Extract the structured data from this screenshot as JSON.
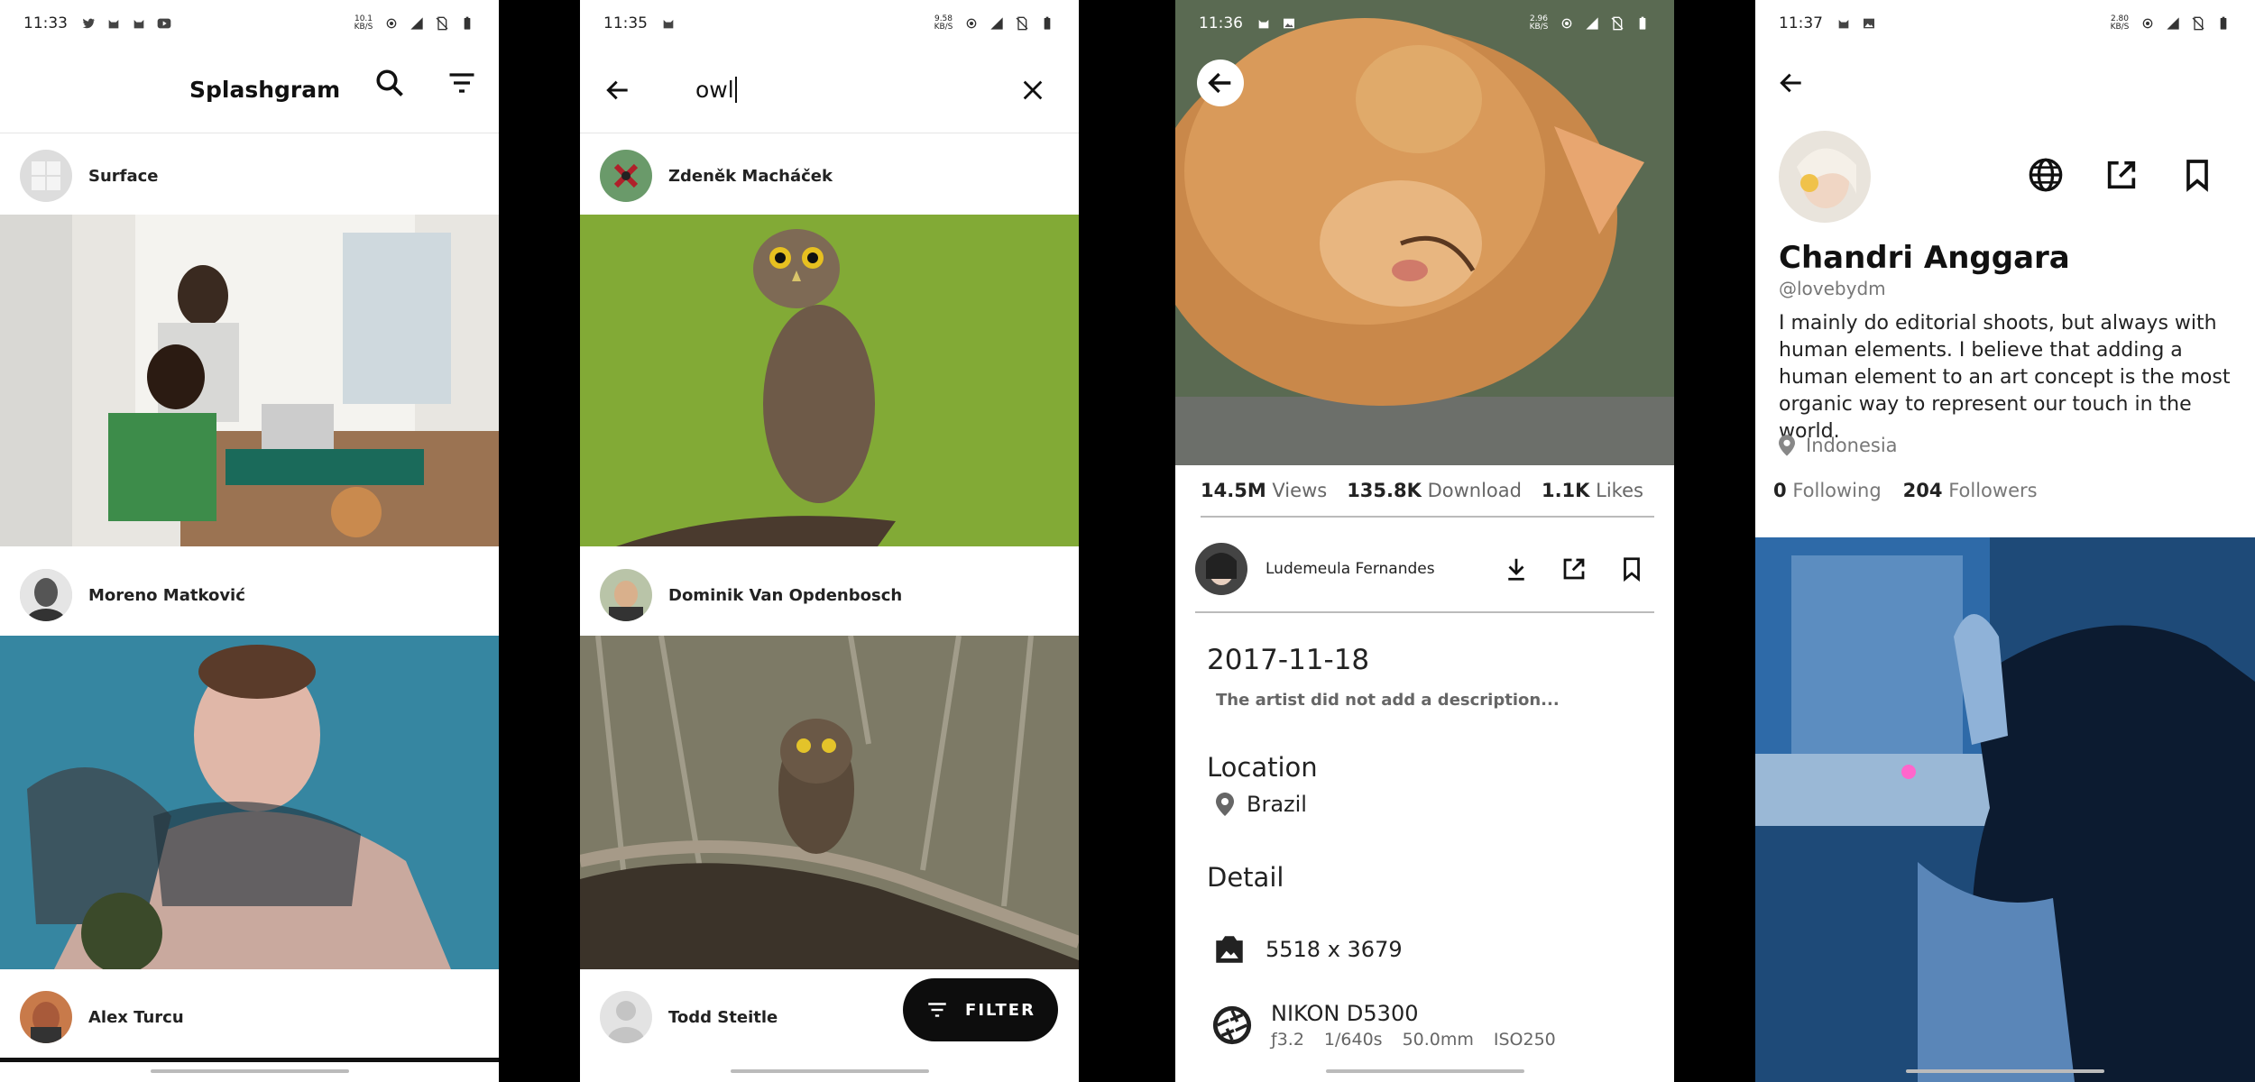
{
  "colors": {
    "accent": "#111111",
    "fab": "#0d0d0d"
  },
  "screen1": {
    "status": {
      "time": "11:33",
      "netspeed": "10.1 KB/S",
      "network": "4G"
    },
    "app_title": "Splashgram",
    "feed": [
      {
        "author": "Surface"
      },
      {
        "author": "Moreno Matković"
      },
      {
        "author": "Alex Turcu"
      }
    ]
  },
  "screen2": {
    "status": {
      "time": "11:35",
      "netspeed": "9.58 KB/S",
      "network": "4G"
    },
    "search_query": "owl",
    "results": [
      {
        "author": "Zdeněk Macháček"
      },
      {
        "author": "Dominik Van Opdenbosch"
      },
      {
        "author": "Todd Steitle"
      }
    ],
    "filter_label": "FILTER"
  },
  "screen3": {
    "status": {
      "time": "11:36",
      "netspeed": "2.96 KB/S",
      "network": "4G"
    },
    "stats": [
      {
        "value": "14.5M",
        "label": "Views"
      },
      {
        "value": "135.8K",
        "label": "Download"
      },
      {
        "value": "1.1K",
        "label": "Likes"
      }
    ],
    "author": "Ludemeula Fernandes",
    "date": "2017-11-18",
    "description": "The artist did not add a description...",
    "location_title": "Location",
    "location": "Brazil",
    "detail_title": "Detail",
    "resolution": "5518 x 3679",
    "camera": "NIKON D5300",
    "exif": {
      "aperture": "ƒ3.2",
      "shutter": "1/640s",
      "focal": "50.0mm",
      "iso": "ISO250"
    }
  },
  "screen4": {
    "status": {
      "time": "11:37",
      "netspeed": "2.80 KB/S",
      "network": "4G"
    },
    "name": "Chandri Anggara",
    "handle": "@lovebydm",
    "bio": "I mainly do editorial shoots, but always with human elements. I believe that adding a human element to an art concept is the most organic way to represent our touch in the world.",
    "location": "Indonesia",
    "following_count": "0",
    "following_label": "Following",
    "followers_count": "204",
    "followers_label": "Followers"
  }
}
